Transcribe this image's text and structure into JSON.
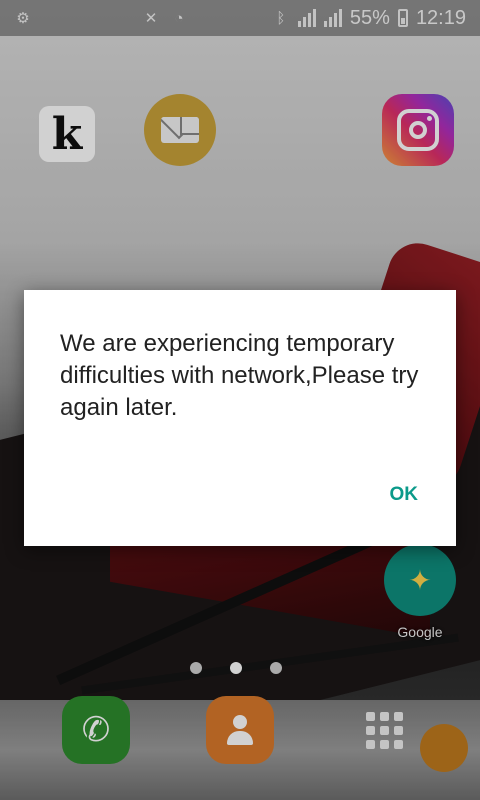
{
  "status_bar": {
    "battery": "55%",
    "time": "12:19",
    "left_icons": [
      "settings-icon",
      "mute-icon",
      "alarm-icon"
    ],
    "right_icons": [
      "bluetooth-icon",
      "wifi-signal-icon",
      "cell-signal-icon",
      "battery-icon"
    ]
  },
  "home": {
    "apps": [
      {
        "name": "kindle",
        "icon": "kindle-icon",
        "glyph": "k",
        "label": ""
      },
      {
        "name": "mail",
        "icon": "mail-icon",
        "label": ""
      },
      {
        "name": "instagram",
        "icon": "instagram-icon",
        "label": ""
      },
      {
        "name": "google-folder",
        "icon": "google-folder-icon",
        "label": "Google"
      }
    ],
    "page_count": 3,
    "active_page": 2,
    "dock": [
      {
        "name": "phone",
        "icon": "phone-icon"
      },
      {
        "name": "contacts",
        "icon": "contacts-icon"
      },
      {
        "name": "apps",
        "icon": "apps-grid-icon"
      }
    ]
  },
  "dialog": {
    "message": "We are experiencing temporary difficulties with network,Please try again later.",
    "ok_label": "OK"
  },
  "colors": {
    "accent": "#0b9a8a",
    "dialog_bg": "#ffffff",
    "message_text": "#222222"
  }
}
